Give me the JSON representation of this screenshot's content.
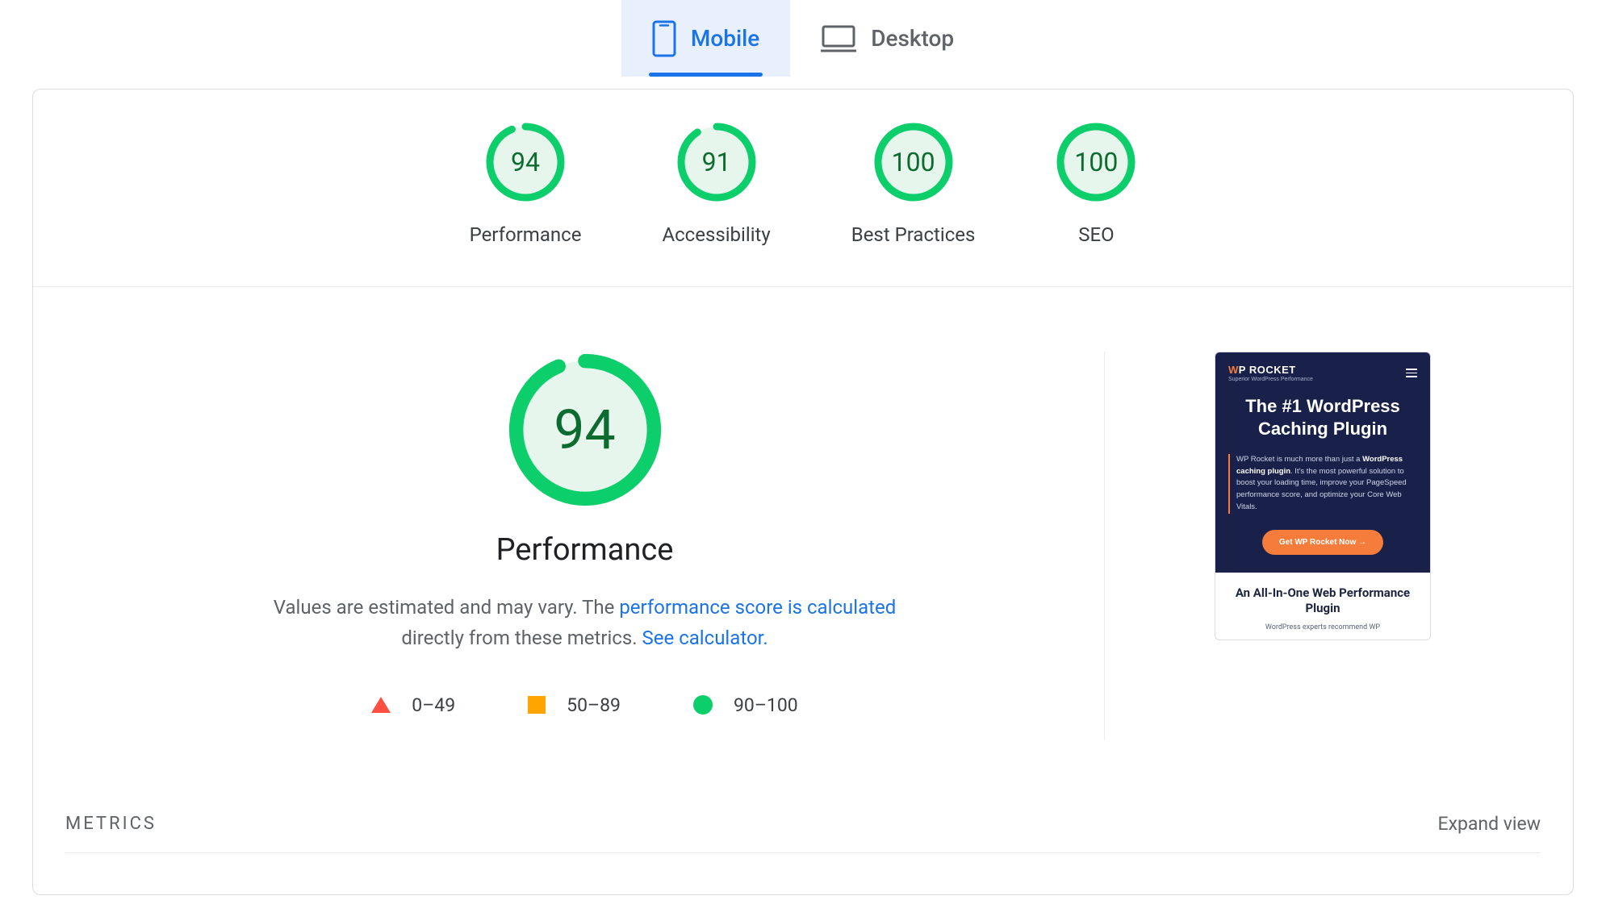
{
  "tabs": {
    "mobile": "Mobile",
    "desktop": "Desktop"
  },
  "summary": {
    "performance": {
      "label": "Performance",
      "score": "94"
    },
    "accessibility": {
      "label": "Accessibility",
      "score": "91"
    },
    "best_practices": {
      "label": "Best Practices",
      "score": "100"
    },
    "seo": {
      "label": "SEO",
      "score": "100"
    }
  },
  "performance": {
    "score": "94",
    "title": "Performance",
    "desc_prefix": "Values are estimated and may vary. The ",
    "link1": "performance score is calculated",
    "desc_mid": " directly from these metrics. ",
    "link2": "See calculator."
  },
  "legend": {
    "r0": "0–49",
    "r1": "50–89",
    "r2": "90–100"
  },
  "preview": {
    "brand_prefix": "W",
    "brand_rest": "P ROCKET",
    "brand_sub": "Superior WordPress Performance",
    "headline": "The #1 WordPress Caching Plugin",
    "body_pre": "WP Rocket is much more than just a ",
    "body_bold": "WordPress caching plugin",
    "body_post": ". It's the most powerful solution to boost your loading time, improve your PageSpeed performance score, and optimize your Core Web Vitals.",
    "cta": "Get WP Rocket Now  →",
    "lower_title": "An All-In-One Web Performance Plugin",
    "lower_sub": "WordPress experts recommend WP"
  },
  "metrics": {
    "title": "METRICS",
    "expand": "Expand view"
  },
  "colors": {
    "green": "#0cce6b",
    "green_fill": "#e6f6ec"
  }
}
